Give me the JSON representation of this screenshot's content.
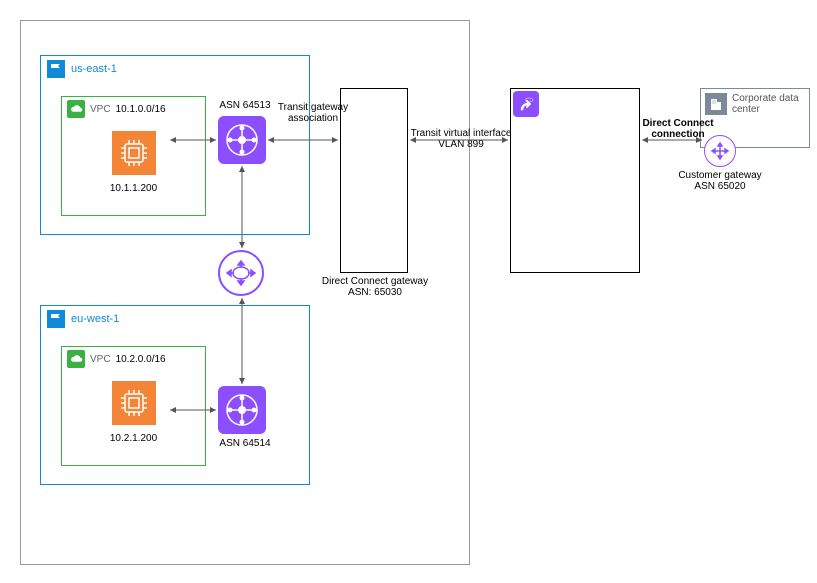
{
  "outer_container": {},
  "regions": [
    {
      "name": "us-east-1",
      "vpc_cidr": "10.1.0.0/16",
      "vpc_label": "VPC",
      "ec2_ip": "10.1.1.200",
      "tgw_asn": "ASN 64513"
    },
    {
      "name": "eu-west-1",
      "vpc_cidr": "10.2.0.0/16",
      "vpc_label": "VPC",
      "ec2_ip": "10.2.1.200",
      "tgw_asn": "ASN 64514"
    }
  ],
  "transit_gateway_association_label": "Transit gateway\nassociation",
  "direct_connect_gateway": "Direct Connect gateway\nASN: 65030",
  "transit_virtual_interface": "Transit virtual interface\nVLAN 899",
  "direct_connect_connection": "Direct Connect\nconnection",
  "customer_gateway": "Customer gateway\nASN 65020",
  "corporate_data_center": "Corporate data\ncenter"
}
